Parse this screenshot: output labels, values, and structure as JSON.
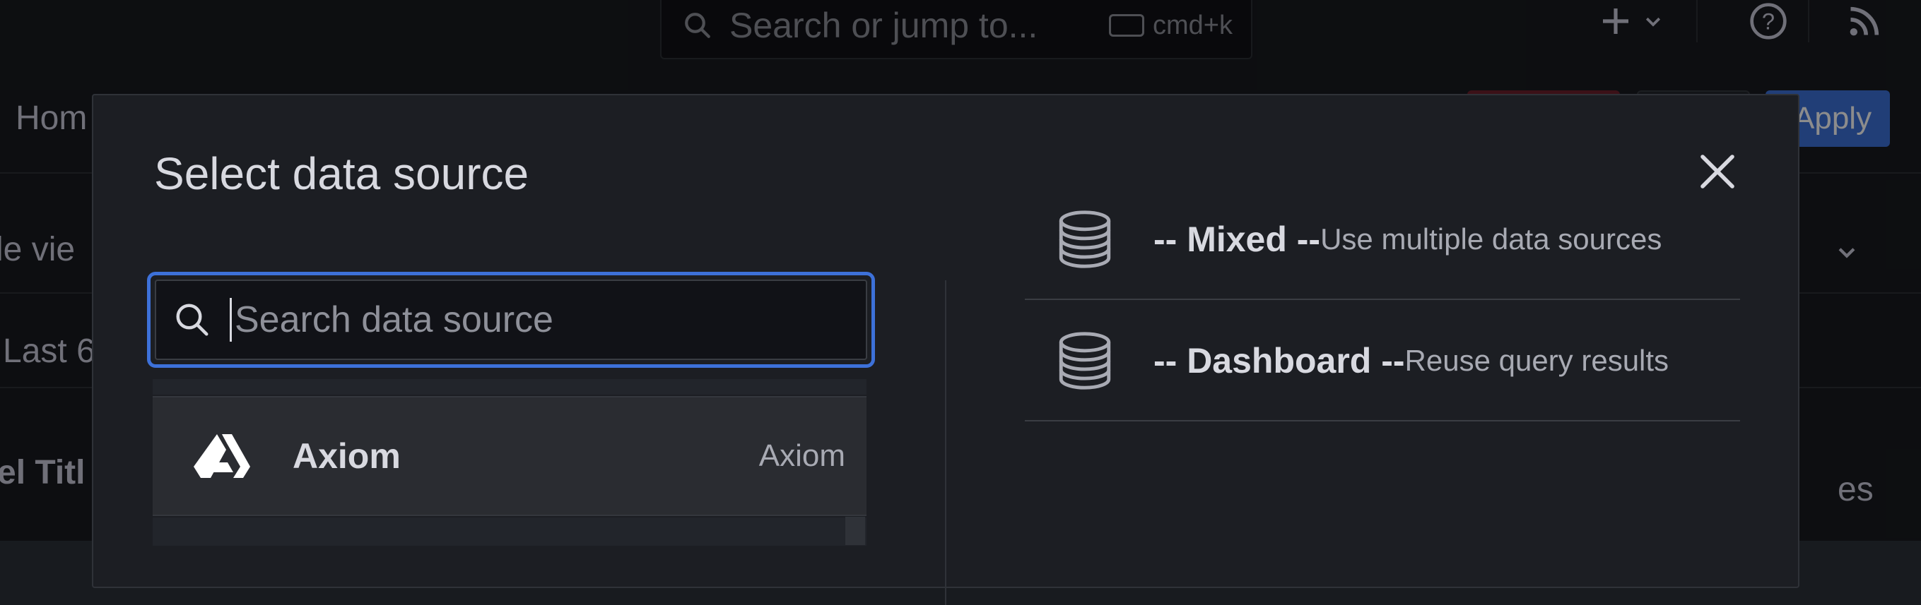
{
  "topbar": {
    "search_placeholder": "Search or jump to...",
    "search_shortcut": "cmd+k",
    "plus_icon": "plus-icon",
    "help_icon": "help-icon",
    "news_icon": "rss-icon"
  },
  "background": {
    "breadcrumb": "Hom",
    "apply_label": "Apply",
    "view_label": "le vie",
    "time_label": "Last 6",
    "panel_title": "el Titl",
    "right_fragment": "es"
  },
  "modal": {
    "title": "Select data source",
    "close_icon": "close-icon",
    "search": {
      "placeholder": "Search data source",
      "value": ""
    },
    "datasources": [
      {
        "name": "Axiom",
        "type": "Axiom",
        "icon": "axiom-logo-icon"
      }
    ],
    "builtin": [
      {
        "name": "-- Mixed --",
        "description": "Use multiple data sources",
        "icon": "database-icon"
      },
      {
        "name": "-- Dashboard --",
        "description": "Reuse query results",
        "icon": "database-icon"
      }
    ]
  },
  "colors": {
    "accent": "#3d71d9",
    "modal_bg": "#1c1e23",
    "text_primary": "#d8d9e0",
    "text_secondary": "#a8aab3"
  }
}
